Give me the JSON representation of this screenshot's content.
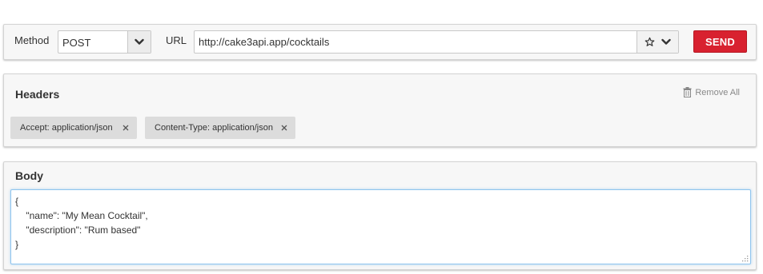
{
  "request": {
    "method_label": "Method",
    "method_value": "POST",
    "url_label": "URL",
    "url_value": "http://cake3api.app/cocktails",
    "send_label": "SEND"
  },
  "headers": {
    "title": "Headers",
    "remove_all_label": "Remove All",
    "items": [
      {
        "label": "Accept: application/json"
      },
      {
        "label": "Content-Type: application/json"
      }
    ]
  },
  "body": {
    "title": "Body",
    "lines": [
      "{",
      "    \"name\": \"My Mean Cocktail\",",
      "    \"description\": \"Rum based\"",
      "}"
    ]
  },
  "icons": {
    "method_dropdown": "chevron-down-icon",
    "url_favorite": "star-icon",
    "url_dropdown": "chevron-down-icon",
    "remove_all": "trash-icon",
    "header_remove": "close-icon",
    "body_resize": "resize-grip-icon"
  },
  "colors": {
    "send_button": "#d8212f",
    "panel_background": "#f7f7f7",
    "chip_background": "#dcdcdc",
    "body_focus_border": "#8ec4ee"
  }
}
